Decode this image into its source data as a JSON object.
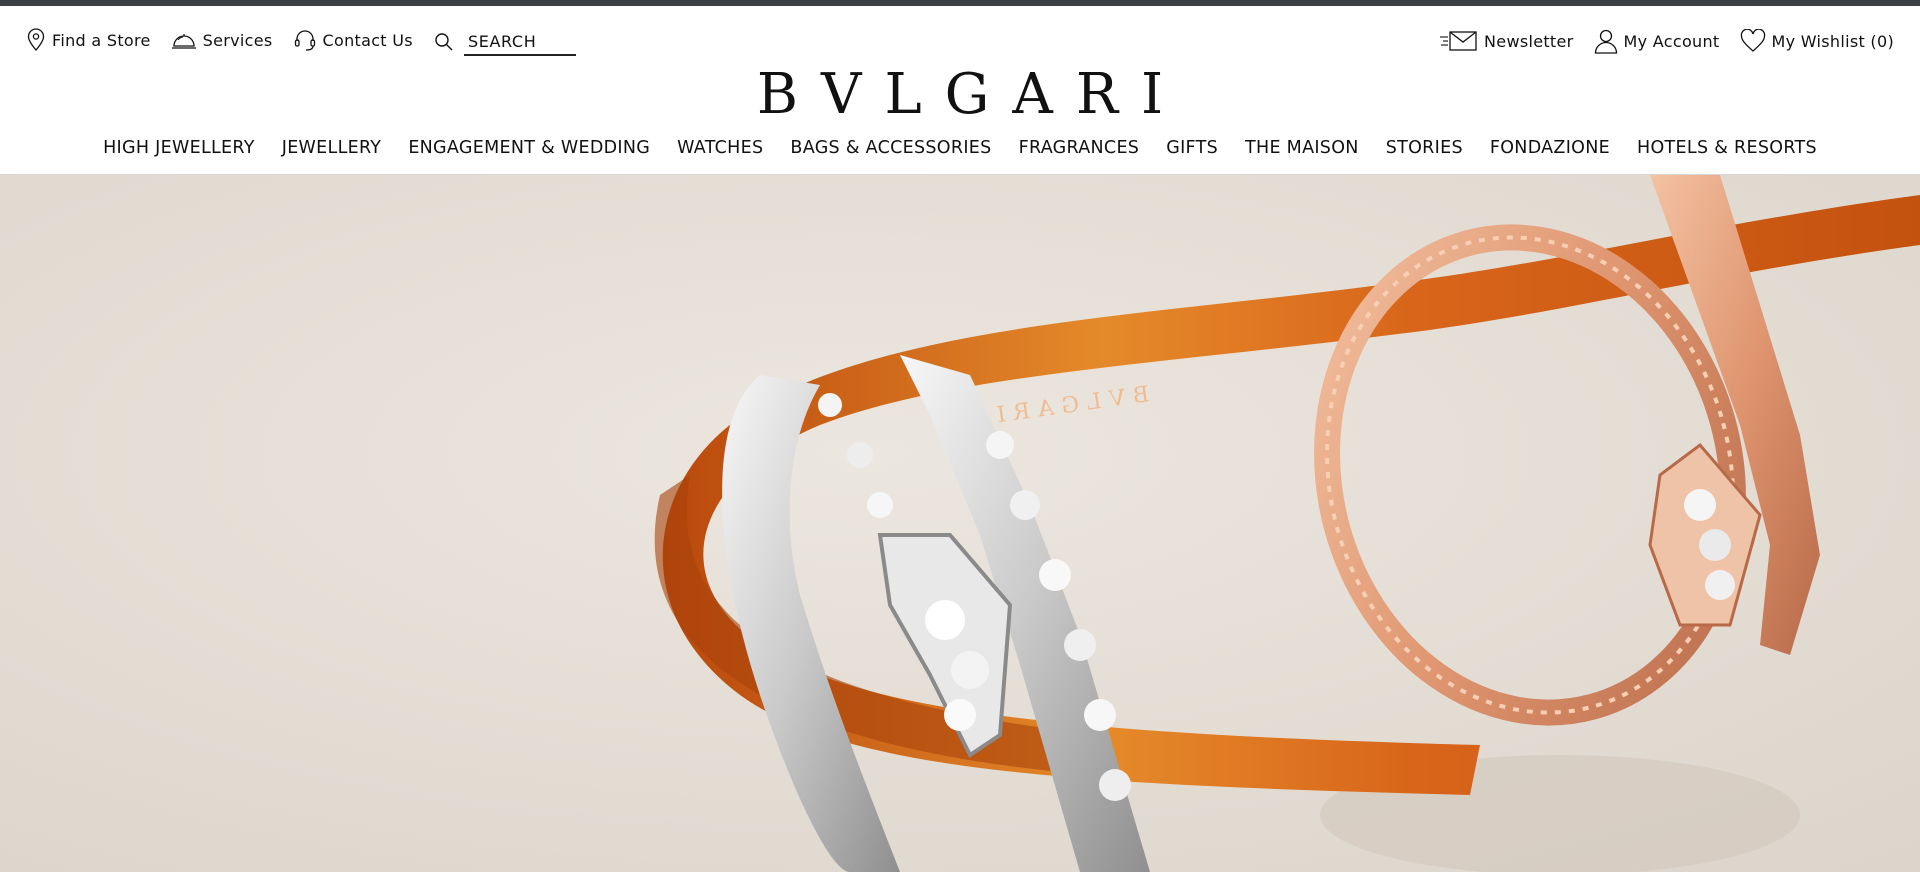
{
  "utility_left": [
    {
      "label": "Find a Store",
      "icon": "location-pin-icon"
    },
    {
      "label": "Services",
      "icon": "service-bell-icon"
    },
    {
      "label": "Contact Us",
      "icon": "headset-icon"
    }
  ],
  "search": {
    "placeholder": "SEARCH",
    "icon": "search-icon"
  },
  "utility_right": [
    {
      "label": "Newsletter",
      "icon": "envelope-icon"
    },
    {
      "label": "My Account",
      "icon": "user-icon"
    },
    {
      "label": "My Wishlist (0)",
      "icon": "heart-icon"
    }
  ],
  "brand": {
    "logo_text": "BVLGARI"
  },
  "nav": [
    "HIGH JEWELLERY",
    "JEWELLERY",
    "ENGAGEMENT & WEDDING",
    "WATCHES",
    "BAGS & ACCESSORIES",
    "FRAGRANCES",
    "GIFTS",
    "THE MAISON",
    "STORIES",
    "FONDAZIONE",
    "HOTELS & RESORTS"
  ],
  "hero": {
    "ribbon_text": "BVLGARI",
    "colors": {
      "background": "#e6e0d8",
      "ribbon": "#d65f12",
      "rose_gold": "#e7a680",
      "silver": "#d9d9d9"
    }
  }
}
